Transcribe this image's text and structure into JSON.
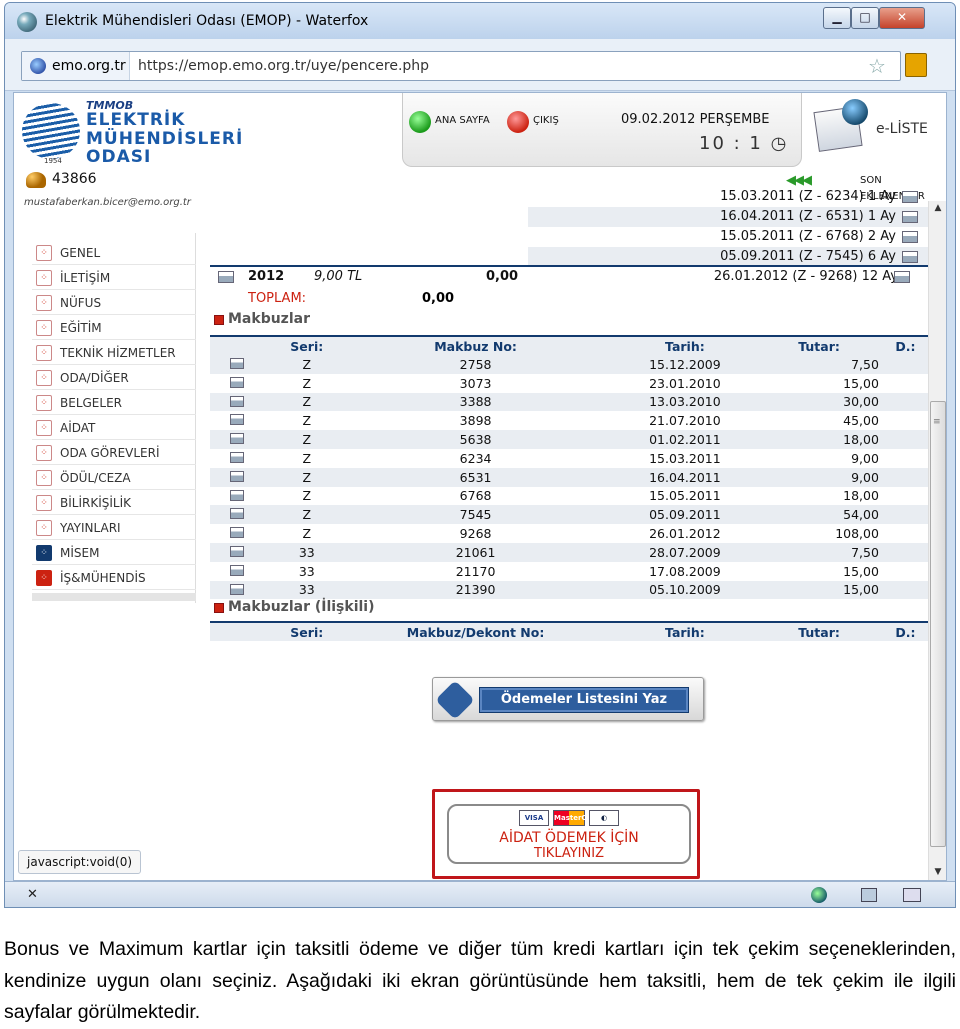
{
  "window": {
    "title": "Elektrik Mühendisleri Odası (EMOP) - Waterfox",
    "min_label": "▁",
    "max_label": "□",
    "close_label": "✕"
  },
  "address_bar": {
    "site": "emo.org.tr",
    "url": "https://emop.emo.org.tr/uye/pencere.php"
  },
  "logo": {
    "line1": "TMMOB",
    "line2": "ELEKTRİK",
    "line3": "MÜHENDİSLERİ",
    "line4": "ODASI",
    "year": "1954"
  },
  "header": {
    "home": "ANA SAYFA",
    "logout": "ÇIKIŞ",
    "date": "09.02.2012 PERŞEMBE",
    "clock": "10 : 1 ◷",
    "eliste": "e-LİSTE"
  },
  "user": {
    "member_no": "43866",
    "email": "mustafaberkan.bicer@emo.org.tr"
  },
  "sidebar": {
    "items": [
      {
        "label": "GENEL"
      },
      {
        "label": "İLETİŞİM"
      },
      {
        "label": "NÜFUS"
      },
      {
        "label": "EĞİTİM"
      },
      {
        "label": "TEKNİK HİZMETLER"
      },
      {
        "label": "ODA/DİĞER"
      },
      {
        "label": "BELGELER"
      },
      {
        "label": "AİDAT"
      },
      {
        "label": "ODA GÖREVLERİ"
      },
      {
        "label": "ÖDÜL/CEZA"
      },
      {
        "label": "BİLİRKİŞİLİK"
      },
      {
        "label": "YAYINLARI"
      },
      {
        "label": "MİSEM"
      },
      {
        "label": "İŞ&MÜHENDİS"
      }
    ]
  },
  "son_eklenenler": {
    "label": "SON EKLENENLER",
    "arrows": "◀◀◀"
  },
  "installments": [
    {
      "text": "15.03.2011 (Z - 6234) 1 Ay"
    },
    {
      "text": "16.04.2011 (Z - 6531) 1 Ay"
    },
    {
      "text": "15.05.2011 (Z - 6768) 2 Ay"
    },
    {
      "text": "05.09.2011 (Z - 7545) 6 Ay"
    }
  ],
  "year_row": {
    "year": "2012",
    "amount": "9,00 TL",
    "paid": "0,00",
    "installment": "26.01.2012 (Z - 9268) 12 Ay"
  },
  "total": {
    "label": "TOPLAM:",
    "value": "0,00"
  },
  "makbuzlar": {
    "title": "Makbuzlar",
    "headers": {
      "seri": "Seri:",
      "no": "Makbuz No:",
      "date": "Tarih:",
      "amount": "Tutar:",
      "d": "D.:"
    },
    "rows": [
      {
        "seri": "Z",
        "no": "2758",
        "date": "15.12.2009",
        "amount": "7,50"
      },
      {
        "seri": "Z",
        "no": "3073",
        "date": "23.01.2010",
        "amount": "15,00"
      },
      {
        "seri": "Z",
        "no": "3388",
        "date": "13.03.2010",
        "amount": "30,00"
      },
      {
        "seri": "Z",
        "no": "3898",
        "date": "21.07.2010",
        "amount": "45,00"
      },
      {
        "seri": "Z",
        "no": "5638",
        "date": "01.02.2011",
        "amount": "18,00"
      },
      {
        "seri": "Z",
        "no": "6234",
        "date": "15.03.2011",
        "amount": "9,00"
      },
      {
        "seri": "Z",
        "no": "6531",
        "date": "16.04.2011",
        "amount": "9,00"
      },
      {
        "seri": "Z",
        "no": "6768",
        "date": "15.05.2011",
        "amount": "18,00"
      },
      {
        "seri": "Z",
        "no": "7545",
        "date": "05.09.2011",
        "amount": "54,00"
      },
      {
        "seri": "Z",
        "no": "9268",
        "date": "26.01.2012",
        "amount": "108,00"
      },
      {
        "seri": "33",
        "no": "21061",
        "date": "28.07.2009",
        "amount": "7,50"
      },
      {
        "seri": "33",
        "no": "21170",
        "date": "17.08.2009",
        "amount": "15,00"
      },
      {
        "seri": "33",
        "no": "21390",
        "date": "05.10.2009",
        "amount": "15,00"
      }
    ]
  },
  "makbuzlar_iliskili": {
    "title": "Makbuzlar (İlişkili)",
    "headers": {
      "seri": "Seri:",
      "no": "Makbuz/Dekont No:",
      "date": "Tarih:",
      "amount": "Tutar:",
      "d": "D.:"
    }
  },
  "buttons": {
    "odeme_list": "Ödemeler Listesini Yaz",
    "aidat_line1": "AİDAT ÖDEMEK İÇİN",
    "aidat_line2": "TIKLAYINIZ",
    "visa": "VISA",
    "mastercard": "MasterCard",
    "diners": "◐"
  },
  "status_link": "javascript:void(0)",
  "statusbar": {
    "close": "✕"
  },
  "caption": "Bonus ve Maximum kartlar için taksitli ödeme ve diğer tüm kredi kartları için tek çekim seçeneklerinden, kendinize uygun olanı seçiniz. Aşağıdaki iki ekran görüntüsünde hem taksitli, hem de tek çekim ile ilgili sayfalar görülmektedir."
}
